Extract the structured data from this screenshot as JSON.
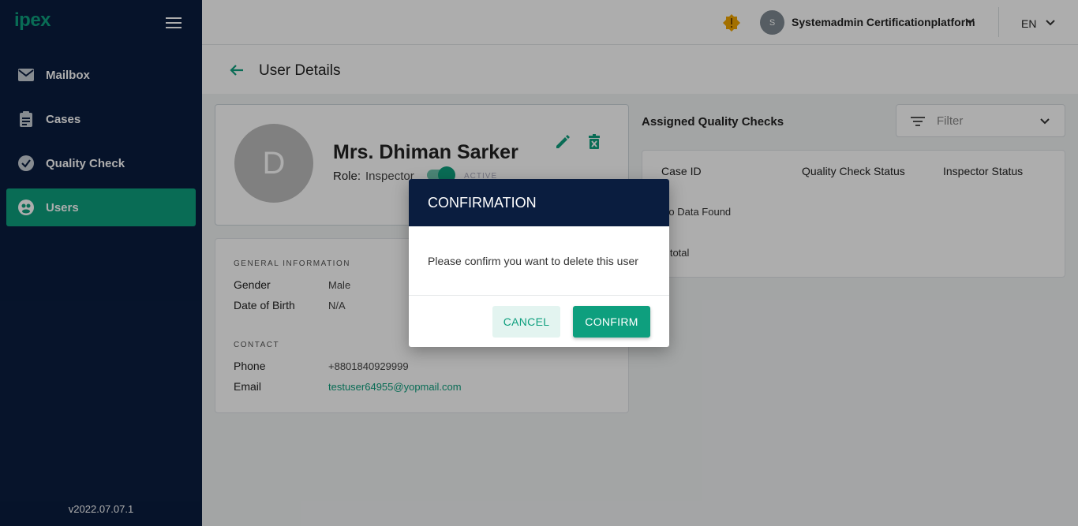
{
  "sidebar": {
    "logo": "ipex",
    "items": [
      {
        "label": "Mailbox",
        "icon": "mail-icon"
      },
      {
        "label": "Cases",
        "icon": "clipboard-icon"
      },
      {
        "label": "Quality Check",
        "icon": "check-circle-icon"
      },
      {
        "label": "Users",
        "icon": "users-icon",
        "active": true
      }
    ],
    "version": "v2022.07.07.1"
  },
  "header": {
    "user_initial": "S",
    "user_name": "Systemadmin Certificationplatform",
    "language": "EN"
  },
  "page": {
    "title": "User Details"
  },
  "profile": {
    "initial": "D",
    "name": "Mrs. Dhiman Sarker",
    "role_label": "Role:",
    "role_value": "Inspector",
    "status": "ACTIVE"
  },
  "info": {
    "general_heading": "GENERAL INFORMATION",
    "gender_label": "Gender",
    "gender_value": "Male",
    "dob_label": "Date of Birth",
    "dob_value": "N/A",
    "contact_heading": "CONTACT",
    "phone_label": "Phone",
    "phone_value": "+8801840929999",
    "email_label": "Email",
    "email_value": "testuser64955@yopmail.com"
  },
  "qc": {
    "title": "Assigned Quality Checks",
    "filter_placeholder": "Filter",
    "columns": [
      "Case ID",
      "Quality Check Status",
      "Inspector Status"
    ],
    "empty_text": "No Data Found",
    "total_text": "0 total"
  },
  "modal": {
    "title": "CONFIRMATION",
    "message": "Please confirm you want to delete this user",
    "cancel_label": "CANCEL",
    "confirm_label": "CONFIRM"
  },
  "colors": {
    "brand": "#0e9f7e",
    "navy": "#0a1d3f",
    "warning": "#f0a500"
  }
}
